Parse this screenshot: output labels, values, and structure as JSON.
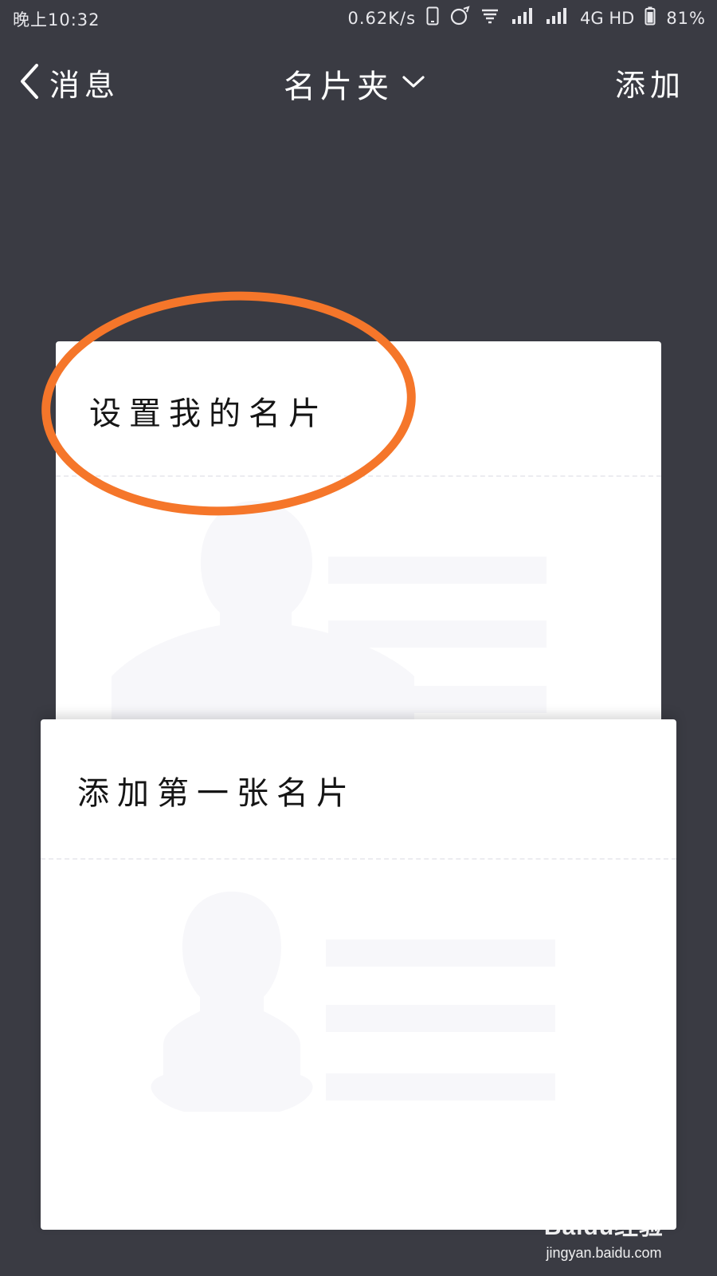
{
  "status_bar": {
    "time": "晚上10:32",
    "net_speed": "0.62K/s",
    "network_type": "4G HD",
    "battery": "81%",
    "icons": [
      "phone-icon",
      "alarm-icon",
      "wifi-icon",
      "signal-icon",
      "signal-icon",
      "battery-icon"
    ]
  },
  "nav": {
    "back_label": "消息",
    "title": "名片夹",
    "add_label": "添加"
  },
  "cards": {
    "my_card_title": "设置我的名片",
    "first_card_title": "添加第一张名片"
  },
  "annotation": {
    "highlight_color": "#f5762a"
  },
  "watermark": {
    "logo": "Baidu经验",
    "url": "jingyan.baidu.com"
  },
  "colors": {
    "background": "#3a3b43",
    "card": "#ffffff",
    "placeholder": "#f7f7fa"
  }
}
